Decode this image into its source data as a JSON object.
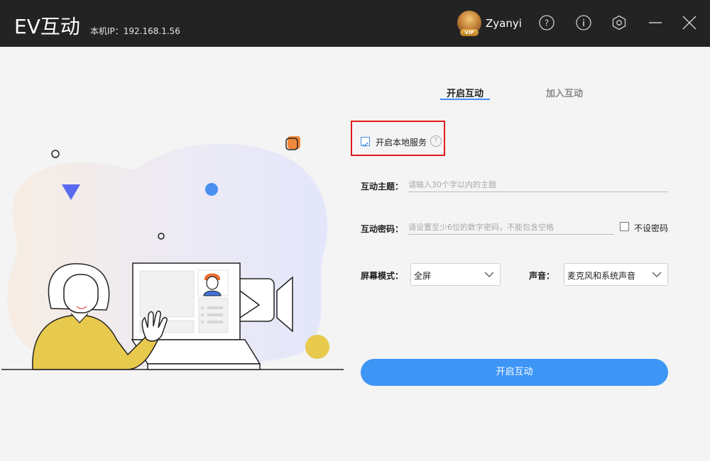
{
  "app": {
    "title": "EV互动",
    "ip_label": "本机IP：192.168.1.56",
    "username": "Zyanyi",
    "vip_badge": "VIP",
    "controls": [
      "help-icon",
      "info-icon",
      "settings-icon",
      "minimize-icon",
      "close-icon"
    ]
  },
  "tabs": [
    {
      "label": "开启互动",
      "active": true
    },
    {
      "label": "加入互动",
      "active": false
    }
  ],
  "local_service": {
    "label": "开启本地服务",
    "checked": true,
    "help_symbol": "?"
  },
  "form": {
    "topic": {
      "label": "互动主题：",
      "placeholder": "请输入30个字以内的主题",
      "value": ""
    },
    "password": {
      "label": "互动密码：",
      "placeholder": "请设置至少6位的数字密码，不能包含空格",
      "value": ""
    },
    "no_password": {
      "label": "不设密码",
      "checked": false
    },
    "screen_mode": {
      "label": "屏幕模式：",
      "value": "全屏"
    },
    "sound": {
      "label": "声音：",
      "value": "麦克风和系统声音"
    }
  },
  "start_button": "开启互动",
  "colors": {
    "titlebar": "#232323",
    "accent": "#3d95f6",
    "highlight": "#e21b1b",
    "background": "#f4f4f4"
  }
}
